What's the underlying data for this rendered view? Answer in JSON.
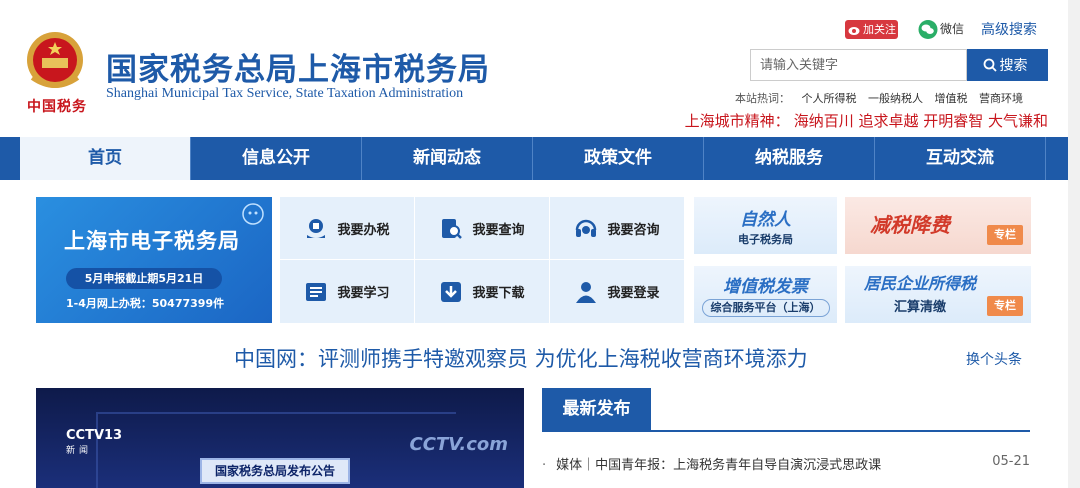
{
  "header": {
    "brand_cn": "中国税务",
    "title": "国家税务总局上海市税务局",
    "subtitle": "Shanghai Municipal Tax Service, State Taxation Administration",
    "follow_label": "加关注",
    "wechat_label": "微信",
    "advanced_search": "高级搜索",
    "search_placeholder": "请输入关键字",
    "search_button": "搜索",
    "hot_words_label": "本站热词：",
    "hot_words": [
      "个人所得税",
      "一般纳税人",
      "增值税",
      "营商环境"
    ],
    "spirit_label": "上海城市精神：",
    "spirit_value": "海纳百川 追求卓越 开明睿智 大气谦和"
  },
  "nav": {
    "items": [
      "首页",
      "信息公开",
      "新闻动态",
      "政策文件",
      "纳税服务",
      "互动交流"
    ],
    "active": 0
  },
  "etax": {
    "title": "上海市电子税务局",
    "deadline": "5月申报截止期5月21日",
    "stats": "1-4月网上办税：50477399件"
  },
  "services": {
    "handle": "我要办税",
    "query": "我要查询",
    "consult": "我要咨询",
    "learn": "我要学习",
    "download": "我要下载",
    "login": "我要登录"
  },
  "banners": {
    "natural_person_1": "自然人",
    "natural_person_2": "电子税务局",
    "tax_cut_1": "减税降费",
    "tax_cut_tag": "专栏",
    "vat_1": "增值税发票",
    "vat_2": "综合服务平台（上海）",
    "resident_1": "居民企业所得税",
    "resident_2": "汇算清缴",
    "resident_tag": "专栏"
  },
  "headline": {
    "text": "中国网：评测师携手特邀观察员 为优化上海税收营商环境添力",
    "change": "换个头条"
  },
  "video": {
    "channel": "CCTV13",
    "channel_sub": "新闻",
    "logo": "CCTV.com",
    "caption": "国家税务总局发布公告"
  },
  "news": {
    "tab": "最新发布",
    "items": [
      {
        "text": "媒体｜中国青年报：上海税务青年自导自演沉浸式思政课",
        "date": "05-21"
      }
    ]
  },
  "colors": {
    "brand_blue": "#1e5aa8",
    "accent_red": "#c8161d"
  }
}
